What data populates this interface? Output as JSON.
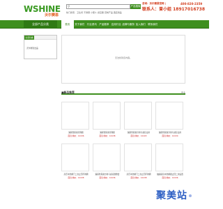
{
  "header": {
    "logo_main": "WSHINE",
    "logo_sub": "沃尔赛恩",
    "search_placeholder": "",
    "search_button": "产品搜索",
    "hot_words": "热门搜索：卫生间 不锈钢 小便斗 感应器 定制产品 酒店用品"
  },
  "contact": {
    "line1": "咨询：沃尔赛恩官网 |",
    "phone1": "400-820-2359",
    "line2": "联系人：曾小姐 18917016738",
    "line3": ""
  },
  "nav": {
    "category_label": "全部产品分类",
    "items": [
      {
        "label": "首页",
        "active": true
      },
      {
        "label": "关于我们",
        "active": false
      },
      {
        "label": "行业资讯",
        "active": false
      },
      {
        "label": "产品推荐",
        "active": false
      },
      {
        "label": "应用行业",
        "active": false
      },
      {
        "label": "品牌与服务",
        "active": false
      },
      {
        "label": "加入我们",
        "active": false
      },
      {
        "label": "联系我们",
        "active": false
      }
    ]
  },
  "sidebar": {
    "tab_label": "全部分类",
    "item": "沃尔赛恩出品"
  },
  "main": {
    "message": "无法找到该内容。"
  },
  "recommend": {
    "title": "■新品推荐",
    "more": "更多",
    "products": [
      {
        "name": "漏尿管尿素分理器",
        "price": "面议/询价：10136"
      },
      {
        "name": "漏尿管尿素分理器",
        "price": "面议/询价：10138"
      },
      {
        "name": "漏尿管尿素分离与感应立用",
        "price": "面议/询价：10103"
      },
      {
        "name": "漏尿管尿素分离与感应立用",
        "price": "面议/询价：10130"
      },
      {
        "name": "高压冲洗阀门二次止回不锈钢",
        "price": "面议/询价：10138"
      },
      {
        "name": "漏尿管尿素分离与感应器整套",
        "price": "面议/询价：10136"
      },
      {
        "name": "高压冲洗阀门二次止回不锈钢",
        "price": "面议/询价：10138"
      },
      {
        "name": "触感感应冲洗阀器止回二次设置",
        "price": "面议/询价：10136"
      }
    ]
  },
  "watermark": {
    "text": "聚美站"
  }
}
